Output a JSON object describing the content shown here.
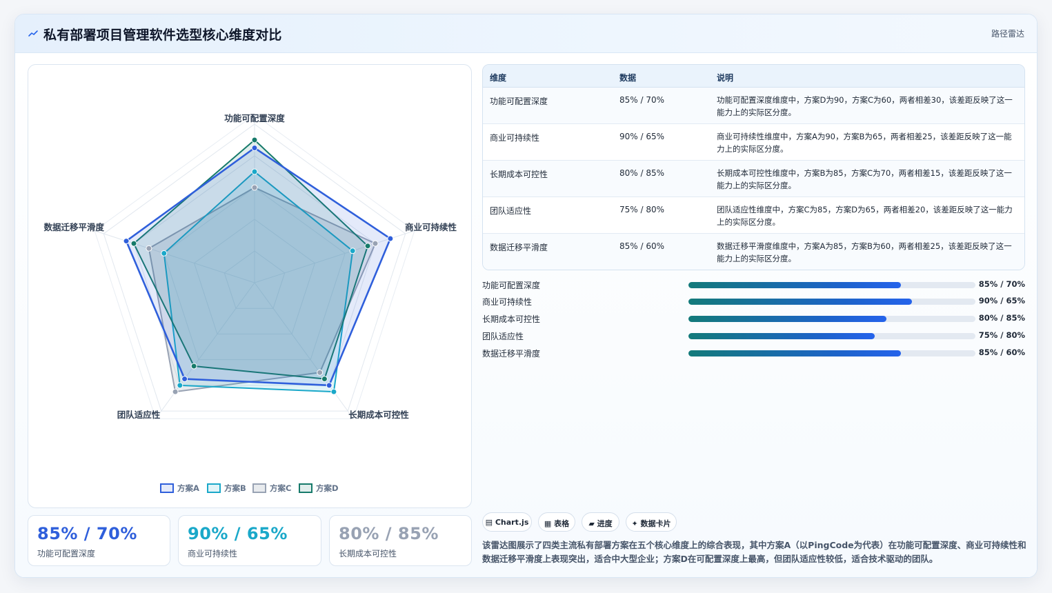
{
  "header": {
    "title": "私有部署项目管理软件选型核心维度对比",
    "tag": "路径雷达"
  },
  "colors": {
    "A": "#2f5fdb",
    "B": "#1aa8c9",
    "C": "#98a2b3",
    "D": "#167a6a"
  },
  "chart_data": {
    "type": "radar",
    "axes": [
      "功能可配置深度",
      "商业可持续性",
      "长期成本可控性",
      "团队适应性",
      "数据迁移平滑度"
    ],
    "range": [
      0,
      100
    ],
    "series": [
      {
        "name": "方案A",
        "values": [
          85,
          90,
          80,
          75,
          85
        ]
      },
      {
        "name": "方案B",
        "values": [
          70,
          65,
          85,
          80,
          60
        ]
      },
      {
        "name": "方案C",
        "values": [
          60,
          80,
          70,
          85,
          70
        ]
      },
      {
        "name": "方案D",
        "values": [
          90,
          75,
          75,
          65,
          80
        ]
      }
    ],
    "legend_position": "bottom"
  },
  "stats": [
    {
      "value": "85% / 70%",
      "label": "功能可配置深度",
      "color": "#2f5fdb"
    },
    {
      "value": "90% / 65%",
      "label": "商业可持续性",
      "color": "#1aa8c9"
    },
    {
      "value": "80% / 85%",
      "label": "长期成本可控性",
      "color": "#98a2b3"
    }
  ],
  "table": {
    "headers": [
      "维度",
      "数据",
      "说明"
    ],
    "rows": [
      {
        "dim": "功能可配置深度",
        "data": "85% / 70%",
        "desc": "功能可配置深度维度中，方案D为90，方案C为60，两者相差30，该差距反映了这一能力上的实际区分度。"
      },
      {
        "dim": "商业可持续性",
        "data": "90% / 65%",
        "desc": "商业可持续性维度中，方案A为90，方案B为65，两者相差25，该差距反映了这一能力上的实际区分度。"
      },
      {
        "dim": "长期成本可控性",
        "data": "80% / 85%",
        "desc": "长期成本可控性维度中，方案B为85，方案C为70，两者相差15，该差距反映了这一能力上的实际区分度。"
      },
      {
        "dim": "团队适应性",
        "data": "75% / 80%",
        "desc": "团队适应性维度中，方案C为85，方案D为65，两者相差20，该差距反映了这一能力上的实际区分度。"
      },
      {
        "dim": "数据迁移平滑度",
        "data": "85% / 60%",
        "desc": "数据迁移平滑度维度中，方案A为85，方案B为60，两者相差25，该差距反映了这一能力上的实际区分度。"
      }
    ]
  },
  "progress": [
    {
      "label": "功能可配置深度",
      "value": "85% / 70%",
      "fill": 0.74
    },
    {
      "label": "商业可持续性",
      "value": "90% / 65%",
      "fill": 0.78
    },
    {
      "label": "长期成本可控性",
      "value": "80% / 85%",
      "fill": 0.69
    },
    {
      "label": "团队适应性",
      "value": "75% / 80%",
      "fill": 0.65
    },
    {
      "label": "数据迁移平滑度",
      "value": "85% / 60%",
      "fill": 0.74
    }
  ],
  "chips": [
    {
      "icon": "▤",
      "label": "Chart.js"
    },
    {
      "icon": "▦",
      "label": "表格"
    },
    {
      "icon": "▰",
      "label": "进度"
    },
    {
      "icon": "✦",
      "label": "数据卡片"
    }
  ],
  "summary": "该雷达图展示了四类主流私有部署方案在五个核心维度上的综合表现，其中方案A（以PingCode为代表）在功能可配置深度、商业可持续性和数据迁移平滑度上表现突出，适合中大型企业；方案D在可配置深度上最高，但团队适应性较低，适合技术驱动的团队。"
}
